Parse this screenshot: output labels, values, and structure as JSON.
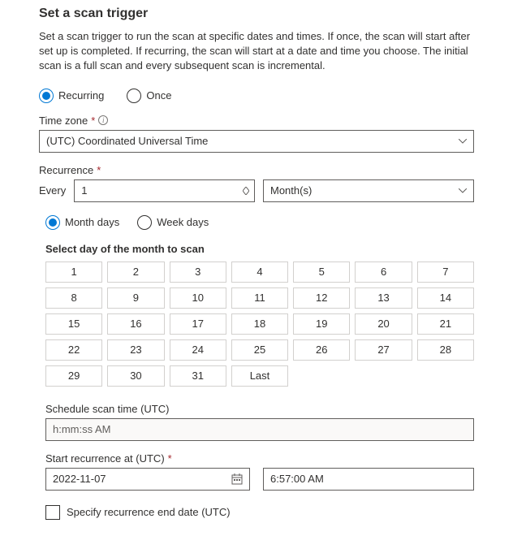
{
  "title": "Set a scan trigger",
  "description": "Set a scan trigger to run the scan at specific dates and times. If once, the scan will start after set up is completed. If recurring, the scan will start at a date and time you choose. The initial scan is a full scan and every subsequent scan is incremental.",
  "triggerType": {
    "recurring": "Recurring",
    "once": "Once"
  },
  "timezone": {
    "label": "Time zone",
    "value": "(UTC) Coordinated Universal Time"
  },
  "recurrence": {
    "label": "Recurrence",
    "everyLabel": "Every",
    "everyValue": "1",
    "unit": "Month(s)"
  },
  "dayType": {
    "monthDays": "Month days",
    "weekDays": "Week days"
  },
  "dayGrid": {
    "heading": "Select day of the month to scan",
    "days": [
      "1",
      "2",
      "3",
      "4",
      "5",
      "6",
      "7",
      "8",
      "9",
      "10",
      "11",
      "12",
      "13",
      "14",
      "15",
      "16",
      "17",
      "18",
      "19",
      "20",
      "21",
      "22",
      "23",
      "24",
      "25",
      "26",
      "27",
      "28",
      "29",
      "30",
      "31",
      "Last"
    ]
  },
  "scheduleTime": {
    "label": "Schedule scan time (UTC)",
    "placeholder": "h:mm:ss AM"
  },
  "startRecurrence": {
    "label": "Start recurrence at (UTC)",
    "date": "2022-11-07",
    "time": "6:57:00 AM"
  },
  "endDate": {
    "label": "Specify recurrence end date (UTC)"
  }
}
